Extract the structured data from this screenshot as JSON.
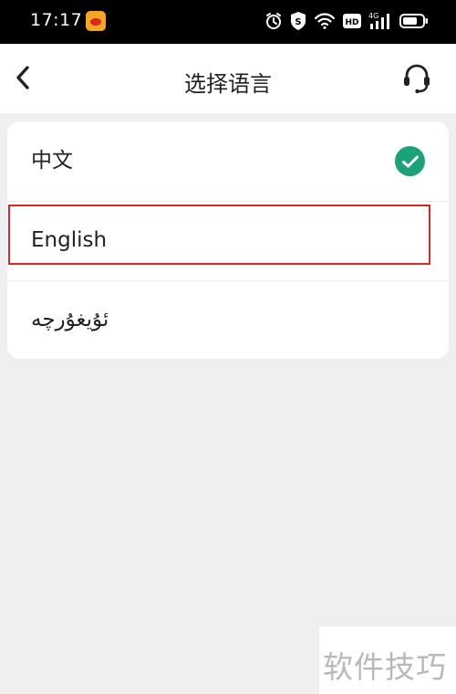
{
  "status_bar": {
    "time": "17:17",
    "icons": [
      "weibo-icon",
      "alarm-icon",
      "shield-icon",
      "wifi-icon",
      "hd-icon",
      "signal-4g-icon",
      "battery-icon"
    ],
    "hd_label": "HD",
    "network_label": "4G"
  },
  "nav": {
    "title": "选择语言",
    "back_icon": "chevron-left-icon",
    "support_icon": "headset-icon"
  },
  "languages": [
    {
      "label": "中文",
      "selected": true
    },
    {
      "label": "English",
      "selected": false
    },
    {
      "label": "ئۇيغۇرچە",
      "selected": false
    }
  ],
  "colors": {
    "check": "#1aa37a",
    "highlight": "#d9272e",
    "background": "#efefef"
  },
  "watermark": "软件技巧"
}
